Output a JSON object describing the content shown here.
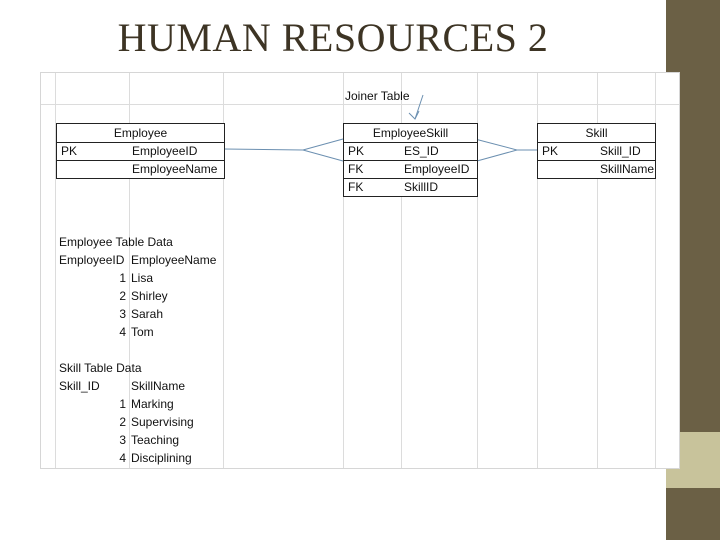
{
  "slide": {
    "title": "HUMAN RESOURCES 2",
    "colors": {
      "side_dark": "#6b6045",
      "side_light": "#c8c39b",
      "title": "#3d3424"
    }
  },
  "diagram": {
    "joiner_label": "Joiner Table",
    "employee": {
      "header": "Employee",
      "rows": [
        {
          "key": "PK",
          "field": "EmployeeID"
        },
        {
          "key": "",
          "field": "EmployeeName"
        }
      ]
    },
    "employee_skill": {
      "header": "EmployeeSkill",
      "rows": [
        {
          "key": "PK",
          "field": "ES_ID"
        },
        {
          "key": "FK",
          "field": "EmployeeID"
        },
        {
          "key": "FK",
          "field": "SkillID"
        }
      ]
    },
    "skill": {
      "header": "Skill",
      "rows": [
        {
          "key": "PK",
          "field": "Skill_ID"
        },
        {
          "key": "",
          "field": "SkillName"
        }
      ]
    }
  },
  "employee_table": {
    "caption": "Employee Table  Data",
    "columns": [
      "EmployeeID",
      "EmployeeName"
    ],
    "rows": [
      [
        "1",
        "Lisa"
      ],
      [
        "2",
        "Shirley"
      ],
      [
        "3",
        "Sarah"
      ],
      [
        "4",
        "Tom"
      ]
    ]
  },
  "skill_table": {
    "caption": "Skill Table Data",
    "columns": [
      "Skill_ID",
      "SkillName"
    ],
    "rows": [
      [
        "1",
        "Marking"
      ],
      [
        "2",
        "Supervising"
      ],
      [
        "3",
        "Teaching"
      ],
      [
        "4",
        "Disciplining"
      ]
    ]
  }
}
